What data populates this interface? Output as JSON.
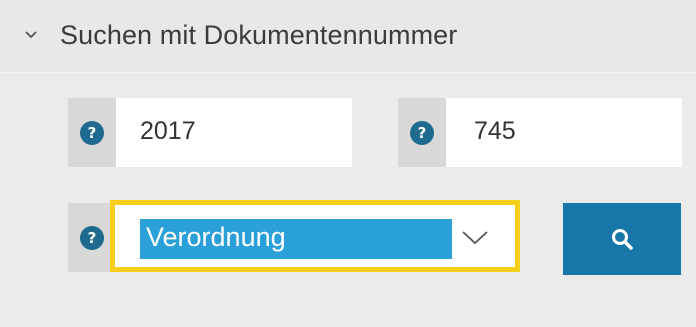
{
  "section": {
    "title": "Suchen mit Dokumentennummer",
    "expanded_icon": "chevron-down-icon"
  },
  "fields": {
    "year": {
      "value": "2017",
      "help_icon": "help-icon",
      "help_glyph": "?"
    },
    "number": {
      "value": "745",
      "help_icon": "help-icon",
      "help_glyph": "?"
    },
    "type": {
      "selected": "Verordnung",
      "help_icon": "help-icon",
      "help_glyph": "?"
    }
  },
  "search_button": {
    "icon": "search-icon"
  },
  "colors": {
    "background": "#ebebeb",
    "help_icon": "#1e6b8f",
    "select_focus": "#f6cf1c",
    "selected_option": "#2a9fd8",
    "search_button": "#1777a8"
  }
}
